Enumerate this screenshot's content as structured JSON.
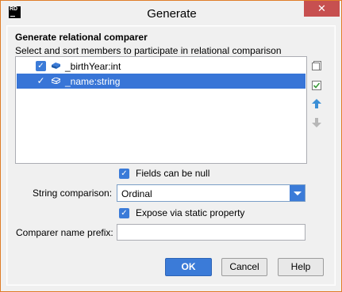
{
  "window": {
    "title": "Generate",
    "app_logo_text": "RD",
    "close_glyph": "✕"
  },
  "section": {
    "heading": "Generate relational comparer",
    "subheading": "Select and sort members to participate in relational comparison"
  },
  "members": [
    {
      "label": "_birthYear:int",
      "checked": true,
      "selected": false
    },
    {
      "label": "_name:string",
      "checked": true,
      "selected": true
    }
  ],
  "options": {
    "fields_null_label": "Fields can be null",
    "string_comparison_label": "String comparison:",
    "string_comparison_value": "Ordinal",
    "expose_label": "Expose via static property",
    "prefix_label": "Comparer name prefix:",
    "prefix_value": ""
  },
  "buttons": {
    "ok": "OK",
    "cancel": "Cancel",
    "help": "Help"
  },
  "icons": {
    "side": [
      "select-all-icon",
      "check-list-icon",
      "move-up-icon",
      "move-down-icon"
    ]
  },
  "colors": {
    "accent": "#3b7bd8",
    "selection": "#3875d7",
    "window_border": "#e07d28",
    "close": "#c75050"
  }
}
